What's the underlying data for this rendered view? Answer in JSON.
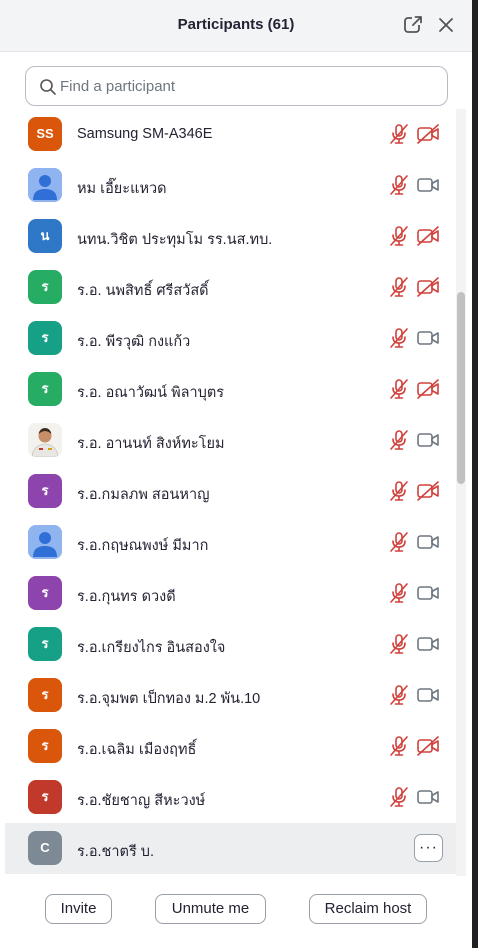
{
  "header": {
    "title": "Participants (61)",
    "popout_icon": "popout-icon",
    "close_icon": "close-icon"
  },
  "search": {
    "placeholder": "Find a participant",
    "value": "",
    "icon": "search-icon"
  },
  "participants": [
    {
      "initials": "SS",
      "avatar_type": "initials",
      "color": "#d9560b",
      "name": "Samsung SM-A346E",
      "mic": "muted",
      "video": "off"
    },
    {
      "initials": "",
      "avatar_type": "default-user",
      "color": "#8fb4f0",
      "name": "หม เอี๊ยะแหวด",
      "mic": "muted",
      "video": "on"
    },
    {
      "initials": "น",
      "avatar_type": "initials",
      "color": "#2f78c8",
      "name": "นทน.วิชิต ประทุมโม รร.นส.ทบ.",
      "mic": "muted",
      "video": "off"
    },
    {
      "initials": "ร",
      "avatar_type": "initials",
      "color": "#27ad63",
      "name": "ร.อ. นพสิทธิ์ ศรีสวัสดิ์",
      "mic": "muted",
      "video": "off"
    },
    {
      "initials": "ร",
      "avatar_type": "initials",
      "color": "#16a085",
      "name": "ร.อ. พีรวุฒิ  กงแก้ว",
      "mic": "muted",
      "video": "on"
    },
    {
      "initials": "ร",
      "avatar_type": "initials",
      "color": "#27ad63",
      "name": "ร.อ. อณาวัฒน์ พิลาบุตร",
      "mic": "muted",
      "video": "off"
    },
    {
      "initials": "",
      "avatar_type": "photo",
      "color": "#e8e4dc",
      "name": "ร.อ. อานนท์ สิงห์ทะโยม",
      "mic": "muted",
      "video": "on"
    },
    {
      "initials": "ร",
      "avatar_type": "initials",
      "color": "#8e44ad",
      "name": "ร.อ.กมลภพ สอนหาญ",
      "mic": "muted",
      "video": "off"
    },
    {
      "initials": "",
      "avatar_type": "default-user",
      "color": "#8fb4f0",
      "name": "ร.อ.กฤษณพงษ์ มีมาก",
      "mic": "muted",
      "video": "on"
    },
    {
      "initials": "ร",
      "avatar_type": "initials",
      "color": "#8e44ad",
      "name": "ร.อ.กุนทร ดวงดี",
      "mic": "muted",
      "video": "on"
    },
    {
      "initials": "ร",
      "avatar_type": "initials",
      "color": "#16a085",
      "name": "ร.อ.เกรียงไกร  อินสองใจ",
      "mic": "muted",
      "video": "on"
    },
    {
      "initials": "ร",
      "avatar_type": "initials",
      "color": "#d9560b",
      "name": "ร.อ.จุมพต   เป็กทอง ม.2 พัน.10",
      "mic": "muted",
      "video": "on"
    },
    {
      "initials": "ร",
      "avatar_type": "initials",
      "color": "#d9560b",
      "name": "ร.อ.เฉลิม เมืองฤทธิ์",
      "mic": "muted",
      "video": "off"
    },
    {
      "initials": "ร",
      "avatar_type": "initials",
      "color": "#c0392b",
      "name": "ร.อ.ชัยชาญ   สีหะวงษ์",
      "mic": "muted",
      "video": "on"
    },
    {
      "initials": "C",
      "avatar_type": "initials",
      "color": "#7d8a96",
      "name": "ร.อ.ชาตรี บ.",
      "mic": "none",
      "video": "none",
      "hovered": true,
      "more_label": "···"
    }
  ],
  "footer": {
    "invite": "Invite",
    "unmute_me": "Unmute me",
    "reclaim_host": "Reclaim host"
  },
  "colors": {
    "muted_red": "#d0413b",
    "video_gray": "#6e7680",
    "header_bg": "#f3f4f6"
  }
}
